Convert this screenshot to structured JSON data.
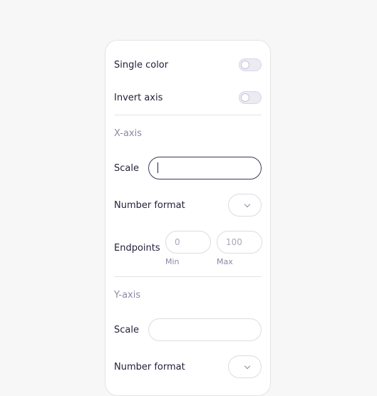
{
  "general": {
    "single_color_label": "Single color",
    "single_color_on": false,
    "invert_axis_label": "Invert axis",
    "invert_axis_on": false
  },
  "x_axis": {
    "title": "X-axis",
    "scale_label": "Scale",
    "scale_value": "",
    "number_format_label": "Number format",
    "endpoints_label": "Endpoints",
    "min_placeholder": "0",
    "max_placeholder": "100",
    "min_caption": "Min",
    "max_caption": "Max"
  },
  "y_axis": {
    "title": "Y-axis",
    "scale_label": "Scale",
    "scale_value": "",
    "number_format_label": "Number format"
  },
  "colors": {
    "background": "#f7f7f7",
    "panel": "#ffffff",
    "text": "#22213a",
    "muted": "#8b88a6"
  }
}
